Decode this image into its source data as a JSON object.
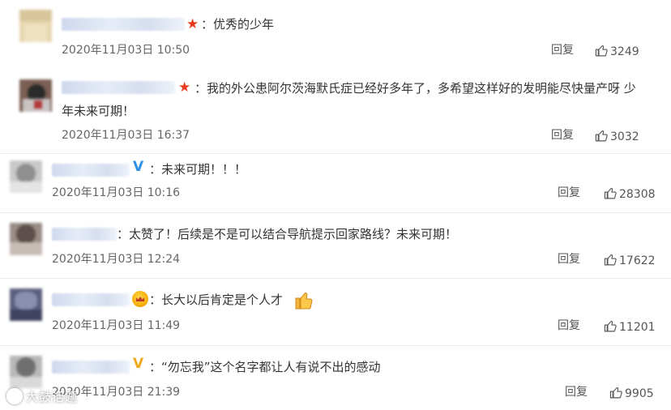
{
  "comments": [
    {
      "badge": "star-badge",
      "text": "：优秀的少年",
      "time": "2020年11月03日 10:50",
      "reply_label": "回复",
      "likes": "3249"
    },
    {
      "badge": "star-badge",
      "text_line1": "：我的外公患阿尔茨海默氏症已经好多年了，多希望这样好的发明能尽快量产呀 少",
      "text_line2": "年未来可期！",
      "time": "2020年11月03日 16:37",
      "reply_label": "回复",
      "likes": "3032"
    },
    {
      "badge": "v-badge",
      "badge_text": "V",
      "text": "：未来可期！！！",
      "time": "2020年11月03日 10:16",
      "reply_label": "回复",
      "likes": "28308"
    },
    {
      "badge": "none",
      "text": "：太赞了！后续是不是可以结合导航提示回家路线？未来可期！",
      "time": "2020年11月03日 12:24",
      "reply_label": "回复",
      "likes": "17622"
    },
    {
      "badge": "crown-badge",
      "text": "：长大以后肯定是个人才",
      "emoji": "thumbs-up-emoji",
      "time": "2020年11月03日 11:49",
      "reply_label": "回复",
      "likes": "11201"
    },
    {
      "badge": "v-badge",
      "badge_text": "V",
      "text": "：“勿忘我”这个名字都让人有说不出的感动",
      "time": "2020年11月03日 21:39",
      "reply_label": "回复",
      "likes": "9905"
    }
  ],
  "watermark": "大鼓话题",
  "colors": {
    "star": "#e8391e",
    "v_badge": "#2f8fe6",
    "crown": "#f4a800",
    "text": "#333333",
    "meta": "#666666",
    "separator": "#ececec"
  },
  "icons": {
    "like": "thumbs-up-outline-icon"
  }
}
